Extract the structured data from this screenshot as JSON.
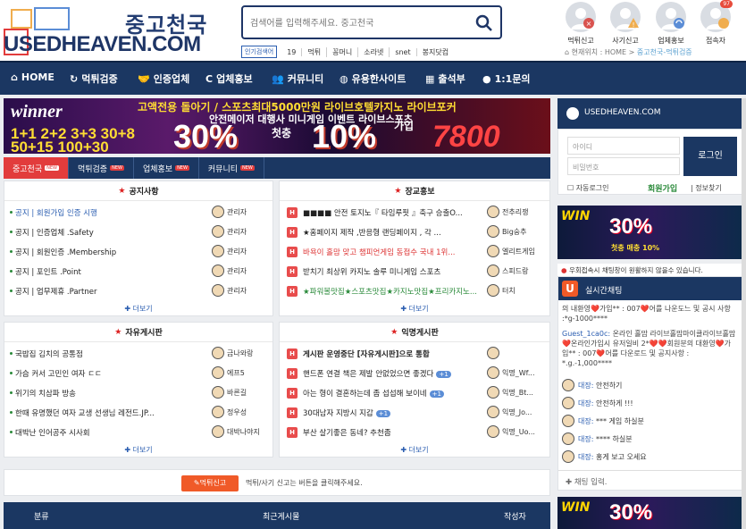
{
  "site": {
    "logo_korean": "중고천국",
    "logo_english": "USEDHEAVEN.COM"
  },
  "search": {
    "placeholder": "검색어를 입력해주세요. 중고천국",
    "popular_label": "인기검색어",
    "keywords": [
      "19",
      "먹튀",
      "꽁머니",
      "소라넷",
      "snet",
      "봉지닷컴"
    ]
  },
  "top_icons": [
    {
      "label": "먹튀신고",
      "icon": "report-user-icon",
      "color": "#d9534f"
    },
    {
      "label": "사기신고",
      "icon": "warning-user-icon",
      "color": "#f0ad4e"
    },
    {
      "label": "업체홍보",
      "icon": "refresh-user-icon",
      "color": "#5b8dd6"
    },
    {
      "label": "접속자",
      "icon": "online-user-icon",
      "badge": "97",
      "color": "#e74c3c"
    }
  ],
  "breadcrumb": {
    "prefix": "현재위치 : HOME > ",
    "current": "중고천국-먹튀검증"
  },
  "nav": [
    {
      "label": "HOME",
      "icon": "home-icon"
    },
    {
      "label": "먹튀검증",
      "icon": "refresh-icon"
    },
    {
      "label": "인증업체",
      "icon": "handshake-icon"
    },
    {
      "label": "업체홍보",
      "icon": "c-icon"
    },
    {
      "label": "커뮤니티",
      "icon": "people-icon"
    },
    {
      "label": "유용한사이트",
      "icon": "globe-icon"
    },
    {
      "label": "출석부",
      "icon": "calendar-icon"
    },
    {
      "label": "1:1문의",
      "icon": "chat-icon"
    }
  ],
  "banner": {
    "brand": "winner",
    "top_text": "고액전용 돌아기 / 스포츠최대5000만원 라이브호텔카지노 라이브포커",
    "sub_text": "안전메이저 대행사   미니게임 이벤트 라이브스포츠",
    "left_numbers": "1+1 2+2 3+3 30+8 50+15 100+30",
    "big_left": "30%",
    "label_mid": "첫충",
    "big_right": "10%",
    "label_right": "가입",
    "right_number": "7800"
  },
  "tabs": [
    {
      "label": "중고천국",
      "new": "NEW",
      "active": true
    },
    {
      "label": "먹튀검증",
      "new": "NEW"
    },
    {
      "label": "업체홍보",
      "new": "NEW"
    },
    {
      "label": "커뮤니티",
      "new": "NEW"
    }
  ],
  "panels": {
    "notice": {
      "title": "공지사항",
      "rows": [
        {
          "title": "공지 | 회원가입 인증 시행",
          "author": "관리자"
        },
        {
          "title": "공지 | 인증업체 .Safety",
          "author": "관리자"
        },
        {
          "title": "공지 | 회원인증 .Membership",
          "author": "관리자"
        },
        {
          "title": "공지 | 포인트 .Point",
          "author": "관리자"
        },
        {
          "title": "공지 | 업무제휴 .Partner",
          "author": "관리자"
        }
      ],
      "more": "더보기"
    },
    "promo": {
      "title": "장교홍보",
      "rows": [
        {
          "title": "■■■■ 안전 토지노『 타임루핏 』축구 승출O...",
          "author": "전추리쟁"
        },
        {
          "title": "★홈페이지 제작 ,반응형 랜딩페이지 , 각 ...",
          "author": "Big숭추"
        },
        {
          "title": "바욕이 홀맘 맞고 챔피언게임 동접수 국내 1위...",
          "author": "엘리트게임"
        },
        {
          "title": "받치기 최상위 카지노 솔루 미니게임 스포츠",
          "author": "스피드랑"
        },
        {
          "title": "★파워볼맛집★스포츠맛집★카지노맛집★프리카지노...",
          "author": "터치"
        }
      ],
      "more": "더보기"
    },
    "free": {
      "title": "자유게시판",
      "rows": [
        {
          "title": "국밥집 김치의 공통점",
          "author": "금나와랑"
        },
        {
          "title": "가슴 커서 고민인 여자 ㄷㄷ",
          "author": "에프5"
        },
        {
          "title": "위기의 치삼파 방송",
          "author": "바른길"
        },
        {
          "title": "한때 유명했던 여자 교생 선생님 레전드.JP...",
          "author": "정우성"
        },
        {
          "title": "대박난 인어공주 시사회",
          "author": "대박나야지"
        }
      ],
      "more": "더보기"
    },
    "anon": {
      "title": "익명게시판",
      "rows": [
        {
          "title": "게시판 운영중단 [자유게시판]으로 통합",
          "author": "",
          "count": ""
        },
        {
          "title": "핸드폰 연결 책은 제발 안없었으면 좋겠다",
          "author": "익명_Wf...",
          "count": "+1"
        },
        {
          "title": "아는 형이 결혼하는데 좀 섭섭해 보이네",
          "author": "익명_Bt...",
          "count": "+1"
        },
        {
          "title": "30대남자 지방시 지갑",
          "author": "익명_Jo...",
          "count": "+1"
        },
        {
          "title": "부산 살기좋은 동네? 추천좀",
          "author": "익명_Uo...",
          "count": ""
        }
      ],
      "more": "더보기"
    }
  },
  "report": {
    "button": "먹튀신고",
    "message": "먹튀/사기 신고는 버튼을 클릭해주세요."
  },
  "table_header": {
    "col1": "분류",
    "col2": "최근게시물",
    "col3": "작성자"
  },
  "sidebar": {
    "site_label": "USEDHEAVEN.COM",
    "id_placeholder": "아이디",
    "pw_placeholder": "비밀번호",
    "login_button": "로그인",
    "auto_login": "자동로그인",
    "join": "회원가입",
    "find": "정보찾기",
    "banner_big": "30%",
    "banner_brand": "WIN",
    "banner_sub": "첫충 매충 10%",
    "warning": "우회접속시 채팅창이 원활하지 않을수 있습니다.",
    "chat_title": "실시간채팅",
    "chat_input_placeholder": "채팅 입력.",
    "chat_system_1": "의 내환영❤️가입** : 007❤️어를 나운도느 및 공시 사항 :*g-1000****",
    "chat_system_2_name": "Guest_1ca0c:",
    "chat_system_2": "온라인 홀맘 라이브홀맘마이클라이브홀맘 ❤️온라인가입시 유저일비 2*❤️❤️회원분의 대환영❤️가입** : 007❤️어를 다운로드 및 공지사항 : *.g.-1,000****",
    "chat_msgs": [
      {
        "name": "대장:",
        "text": "안전하기"
      },
      {
        "name": "대장:",
        "text": "안전하게 !!!"
      },
      {
        "name": "대장:",
        "text": "*** 게임 하실분"
      },
      {
        "name": "대장:",
        "text": "**** 하실분"
      },
      {
        "name": "대장:",
        "text": "홍게 보고 오세요"
      }
    ]
  }
}
